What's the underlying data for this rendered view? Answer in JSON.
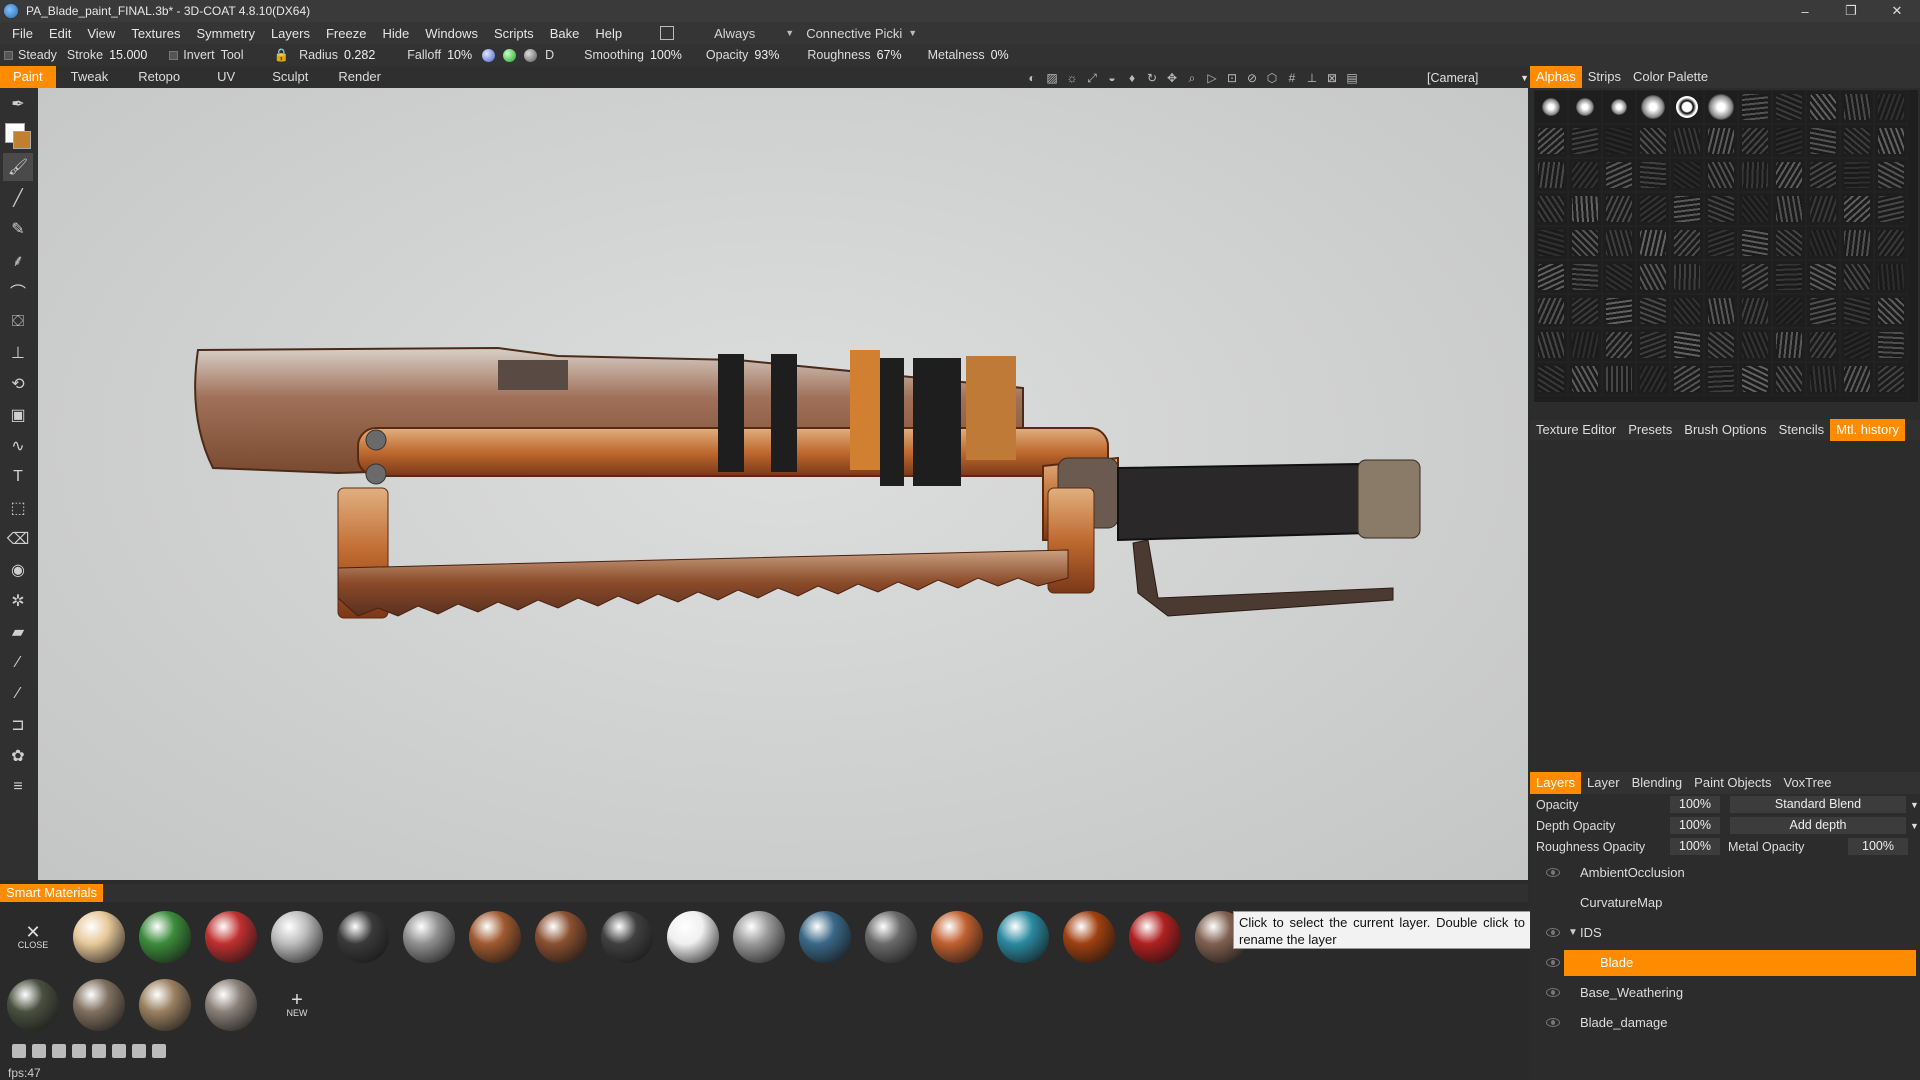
{
  "window": {
    "title": "PA_Blade_paint_FINAL.3b* - 3D-COAT 4.8.10(DX64)",
    "controls": [
      "–",
      "❐",
      "✕"
    ]
  },
  "menu": [
    "File",
    "Edit",
    "View",
    "Textures",
    "Symmetry",
    "Layers",
    "Freeze",
    "Hide",
    "Windows",
    "Scripts",
    "Bake",
    "Help"
  ],
  "menu_extra": {
    "always": "Always",
    "connective": "Connective Picki"
  },
  "brushbar": {
    "steady": "Steady",
    "stroke_label": "Stroke",
    "stroke_value": "15.000",
    "invert": "Invert",
    "tool": "Tool",
    "radius_label": "Radius",
    "radius_value": "0.282",
    "falloff_label": "Falloff",
    "falloff_value": "10%",
    "d_label": "D",
    "smoothing_label": "Smoothing",
    "smoothing_value": "100%",
    "opacity_label": "Opacity",
    "opacity_value": "93%",
    "roughness_label": "Roughness",
    "roughness_value": "67%",
    "metalness_label": "Metalness",
    "metalness_value": "0%"
  },
  "rooms": [
    "Paint",
    "Tweak",
    "Retopo",
    "UV",
    "Sculpt",
    "Render"
  ],
  "camera": "[Camera]",
  "status": {
    "fps": "fps:47"
  },
  "right_tabs": [
    "Alphas",
    "Strips",
    "Color Palette"
  ],
  "right_tabs2": [
    "Texture Editor",
    "Presets",
    "Brush Options",
    "Stencils",
    "Mtl. history"
  ],
  "layers_tabs": [
    "Layers",
    "Layer",
    "Blending",
    "Paint Objects",
    "VoxTree"
  ],
  "layer_props": {
    "opacity_label": "Opacity",
    "opacity_value": "100%",
    "blend": "Standard Blend",
    "depth_label": "Depth Opacity",
    "depth_value": "100%",
    "depth_mode": "Add depth",
    "rough_label": "Roughness Opacity",
    "rough_value": "100%",
    "metal_label": "Metal Opacity",
    "metal_value": "100%"
  },
  "layers": [
    "AmbientOcclusion",
    "CurvatureMap",
    "IDS",
    "Blade",
    "Base_Weathering",
    "Blade_damage"
  ],
  "smart_materials": {
    "tab": "Smart Materials",
    "close": "CLOSE",
    "new": "NEW",
    "tooltip": "Click to select the current layer. Double click to rename the layer",
    "row1_colors": [
      "#e8c89a",
      "#3c8c3c",
      "#c03030",
      "#bdbdbd",
      "#3a3a3a",
      "#909090",
      "#a05a30",
      "#8a5030",
      "#404040",
      "#f0f0f0",
      "#9a9a9a",
      "#3a6888",
      "#6a6a6a",
      "#c06030",
      "#2a8aa0",
      "#a04010",
      "#b02020",
      "#806050"
    ],
    "row2_colors": [
      "#4a5040",
      "#807060",
      "#9a8060",
      "#8a8078"
    ]
  }
}
